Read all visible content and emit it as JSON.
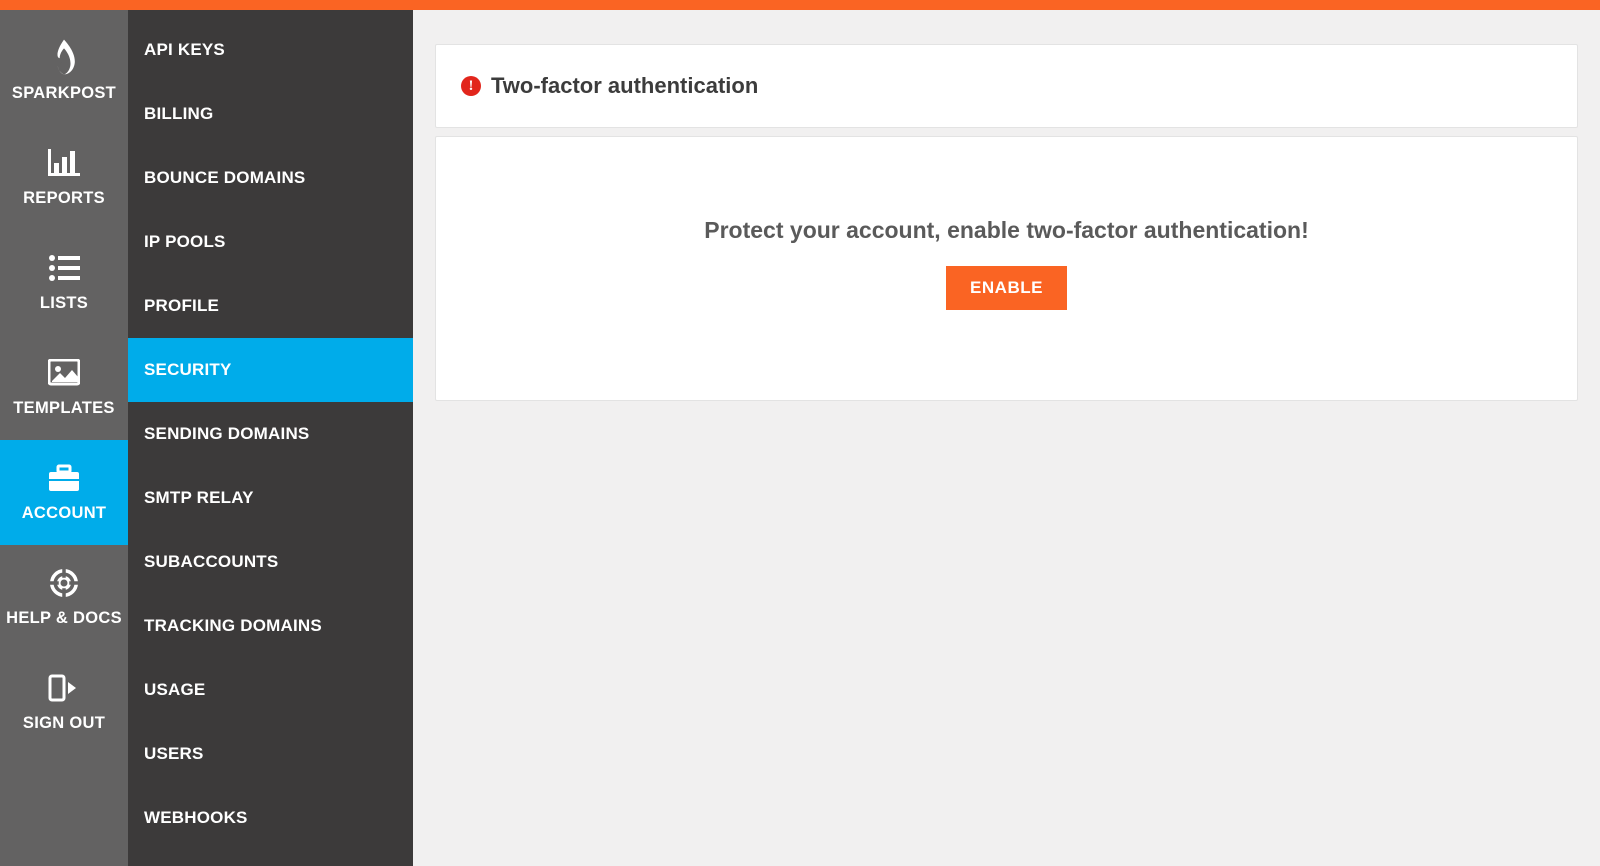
{
  "brand": {
    "name": "SPARKPOST"
  },
  "colors": {
    "accent": "#fa6423",
    "activeBlue": "#00acea",
    "navDark": "#3c3a3a",
    "navMed": "#636262",
    "alertRed": "#e2261c"
  },
  "primaryNav": {
    "items": [
      {
        "id": "brand",
        "label": "SPARKPOST",
        "icon": "flame-icon"
      },
      {
        "id": "reports",
        "label": "REPORTS",
        "icon": "bar-chart-icon"
      },
      {
        "id": "lists",
        "label": "LISTS",
        "icon": "list-icon"
      },
      {
        "id": "templates",
        "label": "TEMPLATES",
        "icon": "image-icon"
      },
      {
        "id": "account",
        "label": "ACCOUNT",
        "icon": "briefcase-icon",
        "active": true
      },
      {
        "id": "help",
        "label": "HELP & DOCS",
        "icon": "life-ring-icon"
      },
      {
        "id": "signout",
        "label": "SIGN OUT",
        "icon": "sign-out-icon"
      }
    ]
  },
  "secondaryNav": {
    "items": [
      {
        "id": "api-keys",
        "label": "API KEYS"
      },
      {
        "id": "billing",
        "label": "BILLING"
      },
      {
        "id": "bounce-domains",
        "label": "BOUNCE DOMAINS"
      },
      {
        "id": "ip-pools",
        "label": "IP POOLS"
      },
      {
        "id": "profile",
        "label": "PROFILE"
      },
      {
        "id": "security",
        "label": "SECURITY",
        "active": true
      },
      {
        "id": "sending-domains",
        "label": "SENDING DOMAINS"
      },
      {
        "id": "smtp-relay",
        "label": "SMTP RELAY"
      },
      {
        "id": "subaccounts",
        "label": "SUBACCOUNTS"
      },
      {
        "id": "tracking-domains",
        "label": "TRACKING DOMAINS"
      },
      {
        "id": "usage",
        "label": "USAGE"
      },
      {
        "id": "users",
        "label": "USERS"
      },
      {
        "id": "webhooks",
        "label": "WEBHOOKS"
      }
    ]
  },
  "main": {
    "header": {
      "icon": "alert-icon",
      "title": "Two-factor authentication"
    },
    "body": {
      "prompt": "Protect your account, enable two-factor authentication!",
      "button_label": "ENABLE"
    }
  }
}
